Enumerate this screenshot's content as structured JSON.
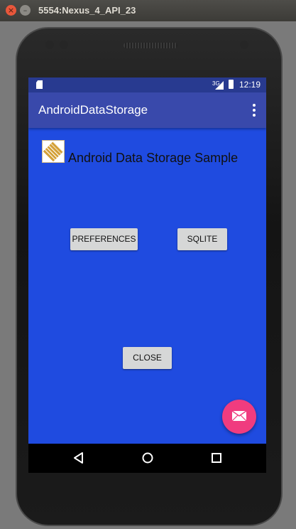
{
  "window": {
    "title": "5554:Nexus_4_API_23",
    "close_glyph": "×",
    "minimize_glyph": "–"
  },
  "status_bar": {
    "network": "3G",
    "time": "12:19"
  },
  "app_bar": {
    "title": "AndroidDataStorage"
  },
  "content": {
    "heading": "Android Data Storage Sample",
    "buttons": {
      "preferences": "PREFERENCES",
      "sqlite": "SQLITE",
      "close": "CLOSE"
    }
  },
  "icons": {
    "sd_card": "sd-card-icon",
    "signal": "signal-icon",
    "battery": "battery-icon",
    "overflow_menu": "more-vert-icon",
    "logo": "app-logo",
    "fab": "email-icon",
    "nav_back": "back-icon",
    "nav_home": "home-icon",
    "nav_recent": "recents-icon"
  },
  "colors": {
    "background": "#1f4be0",
    "app_bar": "#3949ab",
    "status_bar": "#283a90",
    "fab": "#f03c7f",
    "button": "#d6d7d7"
  }
}
